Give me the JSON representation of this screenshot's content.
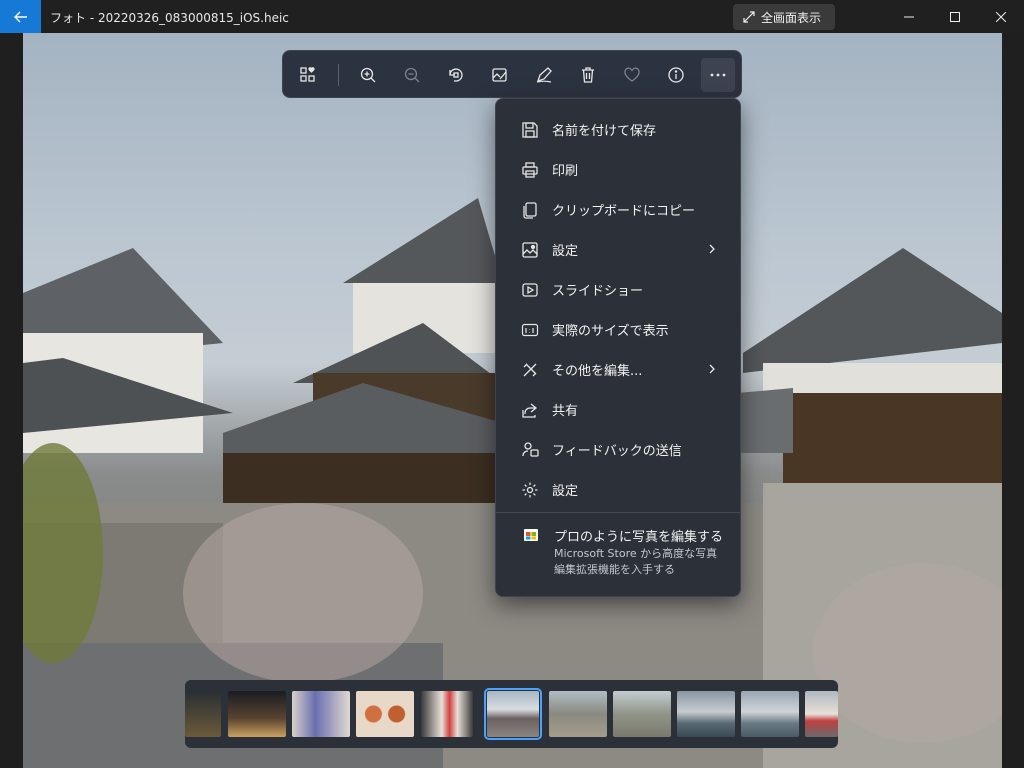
{
  "titlebar": {
    "title": "フォト - 20220326_083000815_iOS.heic",
    "fullscreen_label": "全画面表示",
    "accent": "#1679d6"
  },
  "toolbar": {
    "icons": [
      "view-all-icon",
      "zoom-in-icon",
      "zoom-out-icon",
      "rotate-icon",
      "edit-image-icon",
      "draw-icon",
      "delete-icon",
      "favorite-icon",
      "info-icon",
      "more-icon"
    ]
  },
  "menu": {
    "items": [
      {
        "label": "名前を付けて保存",
        "icon": "save-icon"
      },
      {
        "label": "印刷",
        "icon": "print-icon"
      },
      {
        "label": "クリップボードにコピー",
        "icon": "copy-icon"
      },
      {
        "label": "設定",
        "icon": "set-as-icon",
        "submenu": true
      },
      {
        "label": "スライドショー",
        "icon": "slideshow-icon"
      },
      {
        "label": "実際のサイズで表示",
        "icon": "actual-size-icon"
      },
      {
        "label": "その他を編集...",
        "icon": "edit-more-icon",
        "submenu": true
      },
      {
        "label": "共有",
        "icon": "share-icon"
      },
      {
        "label": "フィードバックの送信",
        "icon": "feedback-icon"
      },
      {
        "label": "設定",
        "icon": "settings-icon"
      }
    ],
    "promo": {
      "title": "プロのように写真を編集する",
      "line1": "Microsoft Store から高度な写真",
      "line2": "編集拡張機能を入手する"
    }
  },
  "filmstrip": {
    "count": 10,
    "selected_index": 5
  }
}
